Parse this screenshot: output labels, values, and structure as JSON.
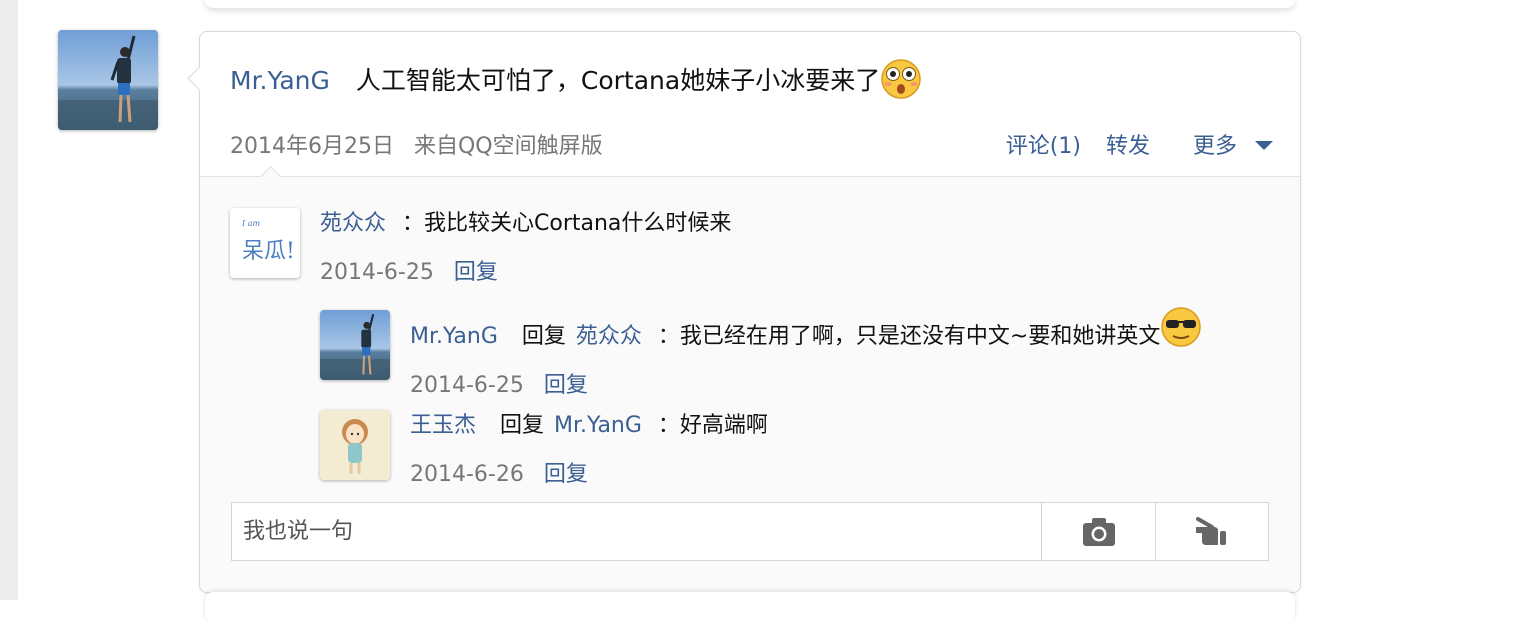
{
  "post": {
    "author": "Mr.YanG",
    "text": "人工智能太可怕了，Cortana她妹子小冰要来了",
    "emoji": "shocked-face-emoji",
    "date": "2014年6月25日",
    "source": "来自QQ空间触屏版",
    "actions": {
      "comment": "评论(1)",
      "share": "转发",
      "more": "更多"
    }
  },
  "comments": [
    {
      "author": "苑众众",
      "text": "：我比较关心Cortana什么时候来",
      "date": "2014-6-25",
      "reply_label": "回复",
      "avatar_text_small": "I am",
      "avatar_text_big": "呆瓜!",
      "replies": [
        {
          "author": "Mr.YanG",
          "reply_word": "回复",
          "target": "苑众众",
          "text": "：我已经在用了啊，只是还没有中文~要和她讲英文",
          "emoji": "cool-sunglasses-emoji",
          "date": "2014-6-25",
          "reply_label": "回复"
        },
        {
          "author": "王玉杰",
          "reply_word": "回复",
          "target": "Mr.YanG",
          "text": "：好高端啊",
          "date": "2014-6-26",
          "reply_label": "回复"
        }
      ]
    }
  ],
  "comment_input": {
    "placeholder": "我也说一句",
    "camera_icon": "camera-icon",
    "emoji_icon": "hand-gesture-icon"
  },
  "colors": {
    "link": "#3b5f93",
    "meta": "#777777",
    "border": "#d9d9d9"
  }
}
